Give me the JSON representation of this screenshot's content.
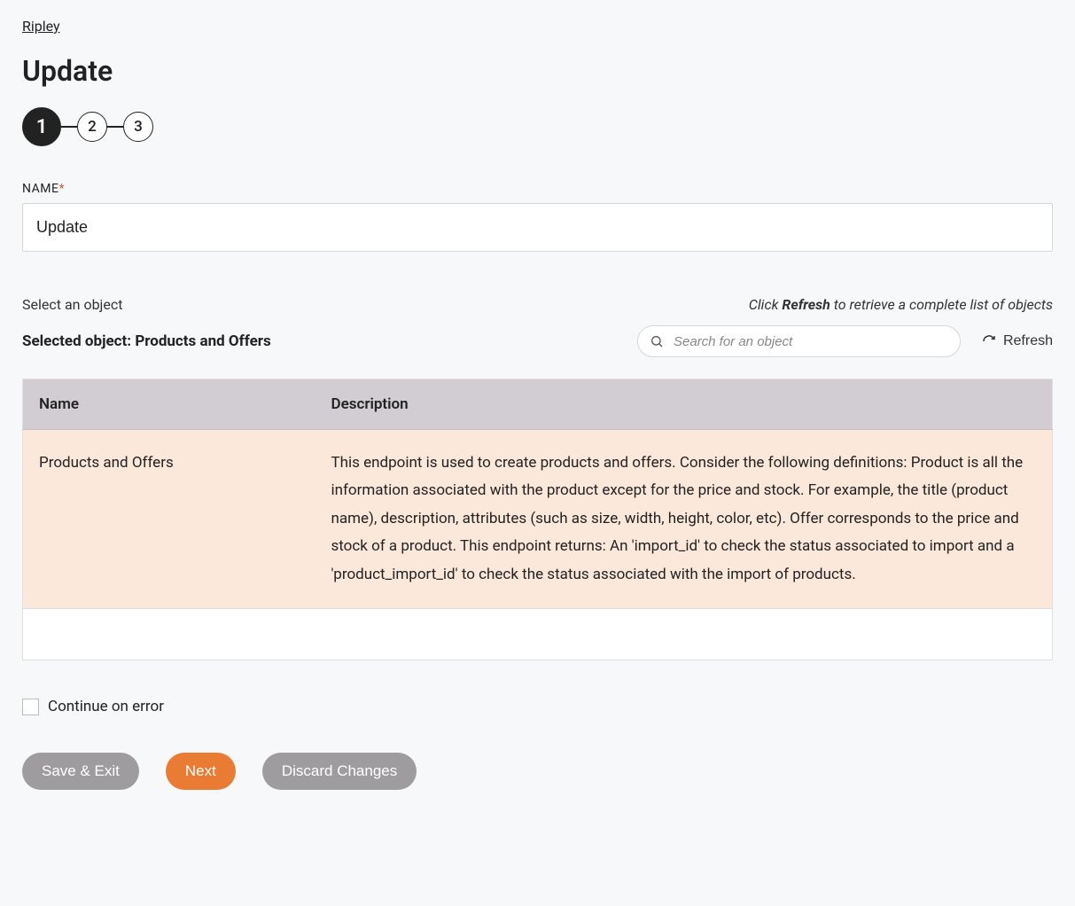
{
  "breadcrumb": {
    "label": "Ripley"
  },
  "page": {
    "title": "Update"
  },
  "stepper": {
    "steps": [
      "1",
      "2",
      "3"
    ],
    "active_index": 0
  },
  "name_field": {
    "label": "NAME",
    "required_mark": "*",
    "value": "Update"
  },
  "object_section": {
    "hint_left": "Select an object",
    "hint_right_prefix": "Click ",
    "hint_right_bold": "Refresh",
    "hint_right_suffix": " to retrieve a complete list of objects",
    "selected_prefix": "Selected object: ",
    "selected_name": "Products and Offers",
    "search_placeholder": "Search for an object",
    "refresh_label": "Refresh"
  },
  "table": {
    "headers": [
      "Name",
      "Description"
    ],
    "rows": [
      {
        "name": "Products and Offers",
        "description": "This endpoint is used to create products and offers. Consider the following definitions: Product is all the information associated with the product except for the price and stock. For example, the title (product name), description, attributes (such as size, width, height, color, etc). Offer corresponds to the price and stock of a product. This endpoint returns: An 'import_id' to check the status associated to import and a 'product_import_id' to check the status associated with the import of products.",
        "selected": true
      }
    ]
  },
  "continue_on_error": {
    "label": "Continue on error",
    "checked": false
  },
  "buttons": {
    "save_exit": "Save & Exit",
    "next": "Next",
    "discard": "Discard Changes"
  }
}
